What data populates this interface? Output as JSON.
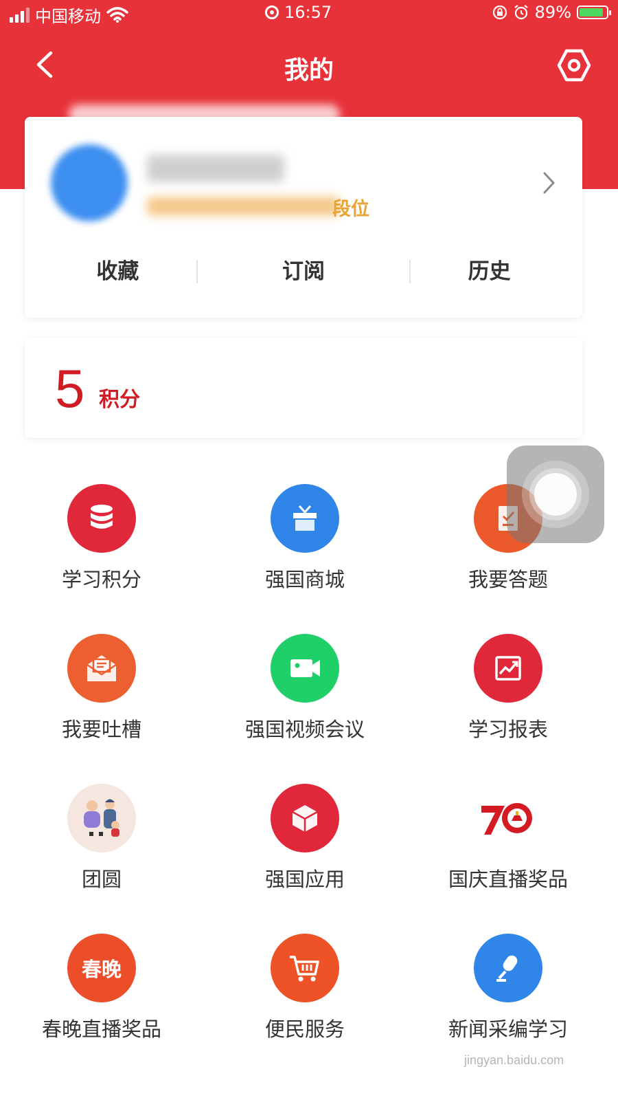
{
  "status_bar": {
    "carrier": "中国移动",
    "time": "16:57",
    "battery": "89%",
    "battery_level": 0.89
  },
  "header": {
    "title": "我的"
  },
  "profile": {
    "rank_visible": "段位",
    "tabs": [
      "收藏",
      "订阅",
      "历史"
    ]
  },
  "points": {
    "value": "5",
    "unit": "积分"
  },
  "grid": [
    {
      "label": "学习积分",
      "icon": "database-icon",
      "color": "#e0283a"
    },
    {
      "label": "强国商城",
      "icon": "gift-icon",
      "color": "#2f86e8"
    },
    {
      "label": "我要答题",
      "icon": "quiz-icon",
      "color": "#ec5a2c"
    },
    {
      "label": "我要吐槽",
      "icon": "mail-icon",
      "color": "#ed5f30"
    },
    {
      "label": "强国视频会议",
      "icon": "video-camera-icon",
      "color": "#1fcf68"
    },
    {
      "label": "学习报表",
      "icon": "chart-report-icon",
      "color": "#e0283a"
    },
    {
      "label": "团圆",
      "icon": "family-illustration-icon",
      "color": "#f6e6e0"
    },
    {
      "label": "强国应用",
      "icon": "cube-icon",
      "color": "#e0283a"
    },
    {
      "label": "国庆直播奖品",
      "icon": "seventy-anniversary-icon",
      "color": "#ffffff"
    },
    {
      "label": "春晚直播奖品",
      "icon": "spring-gala-icon",
      "color": "#ec4e2a",
      "badge": "春晚"
    },
    {
      "label": "便民服务",
      "icon": "shopping-cart-icon",
      "color": "#ed5326"
    },
    {
      "label": "新闻采编学习",
      "icon": "microphone-icon",
      "color": "#2f86e8"
    }
  ],
  "watermark": "jingyan.baidu.com"
}
